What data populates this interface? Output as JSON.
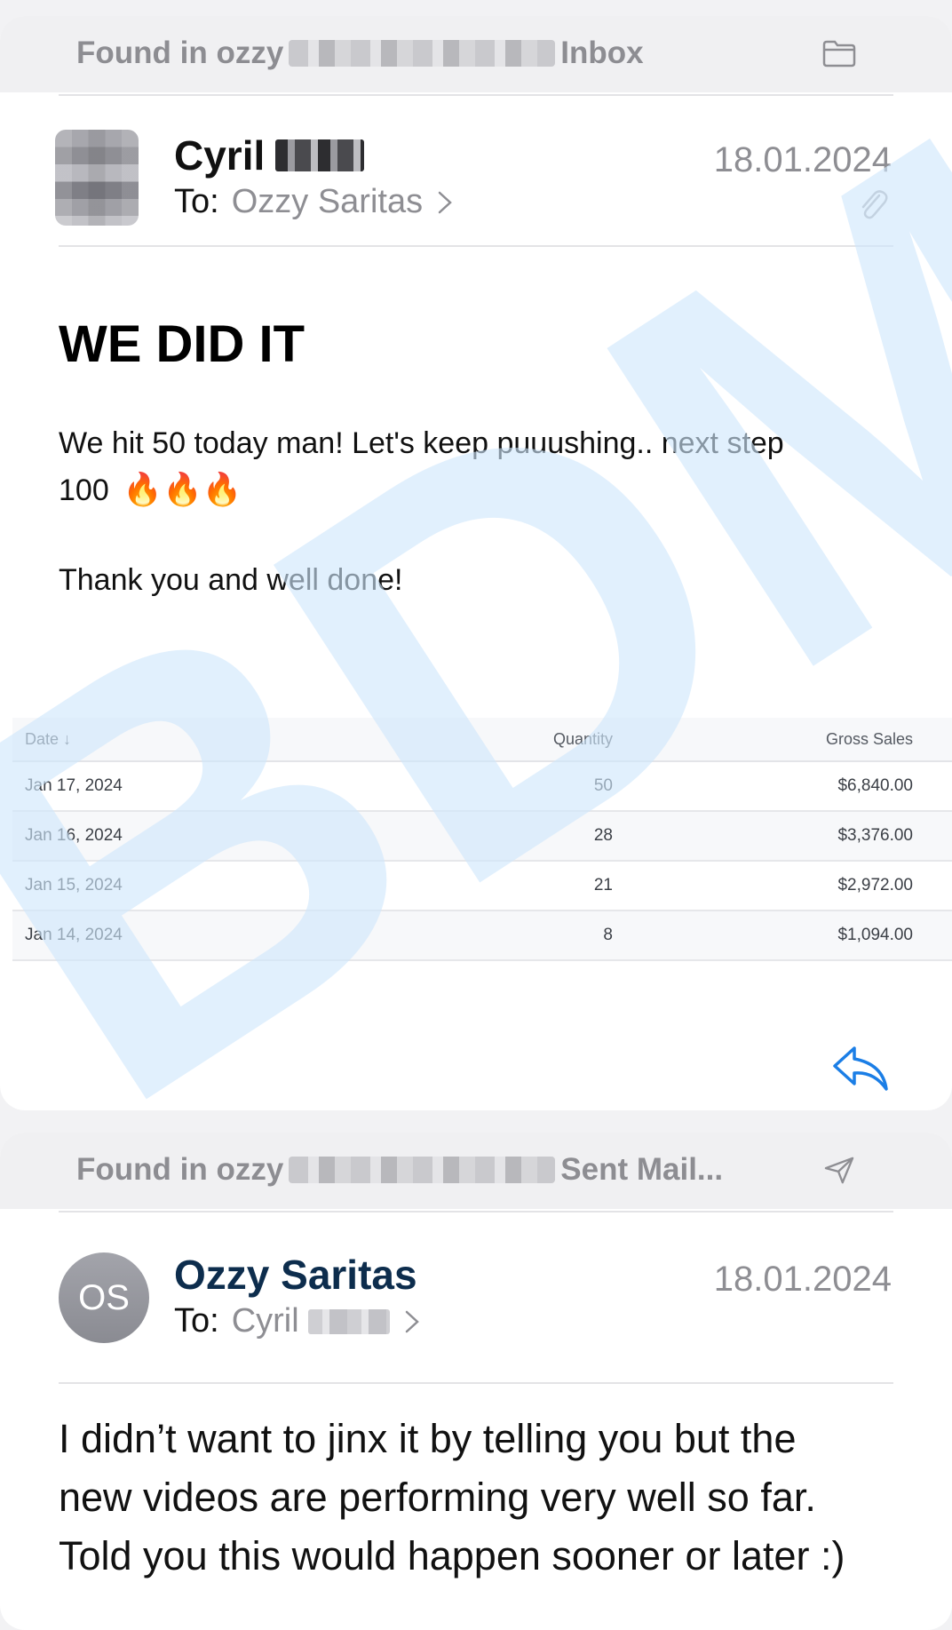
{
  "message1": {
    "found_prefix": "Found in ozzy",
    "found_suffix": "Inbox",
    "sender_first": "Cyril",
    "to_label": "To:",
    "to_name": "Ozzy Saritas",
    "date": "18.01.2024",
    "subject": "WE DID IT",
    "body_line1": "We hit 50 today man! Let's keep puuushing.. next step",
    "body_line2": "100",
    "body_fire": "🔥🔥🔥",
    "body_line3": "Thank you and well done!",
    "table": {
      "headers": {
        "date": "Date ↓",
        "quantity": "Quantity",
        "gross": "Gross Sales"
      },
      "rows": [
        {
          "date": "Jan 17, 2024",
          "quantity": "50",
          "gross": "$6,840.00"
        },
        {
          "date": "Jan 16, 2024",
          "quantity": "28",
          "gross": "$3,376.00"
        },
        {
          "date": "Jan 15, 2024",
          "quantity": "21",
          "gross": "$2,972.00"
        },
        {
          "date": "Jan 14, 2024",
          "quantity": "8",
          "gross": "$1,094.00"
        }
      ]
    }
  },
  "message2": {
    "found_prefix": "Found in ozzy",
    "found_suffix": "Sent Mail...",
    "sender": "Ozzy Saritas",
    "avatar_initials": "OS",
    "to_label": "To:",
    "to_name": "Cyril",
    "date": "18.01.2024",
    "body_line1": "I didn’t want to jinx it by telling you but the",
    "body_line2": "new videos are performing very well so far.",
    "body_line3": "Told you this would happen sooner or later :)"
  },
  "watermark": {
    "text": "BDM",
    "color": "#cfe6fb"
  },
  "icons": [
    "folder-icon",
    "paperclip-icon",
    "chevron-right-icon",
    "reply-icon",
    "send-icon"
  ],
  "colors": {
    "accent": "#1b7ee6",
    "muted": "#8e8e93"
  }
}
